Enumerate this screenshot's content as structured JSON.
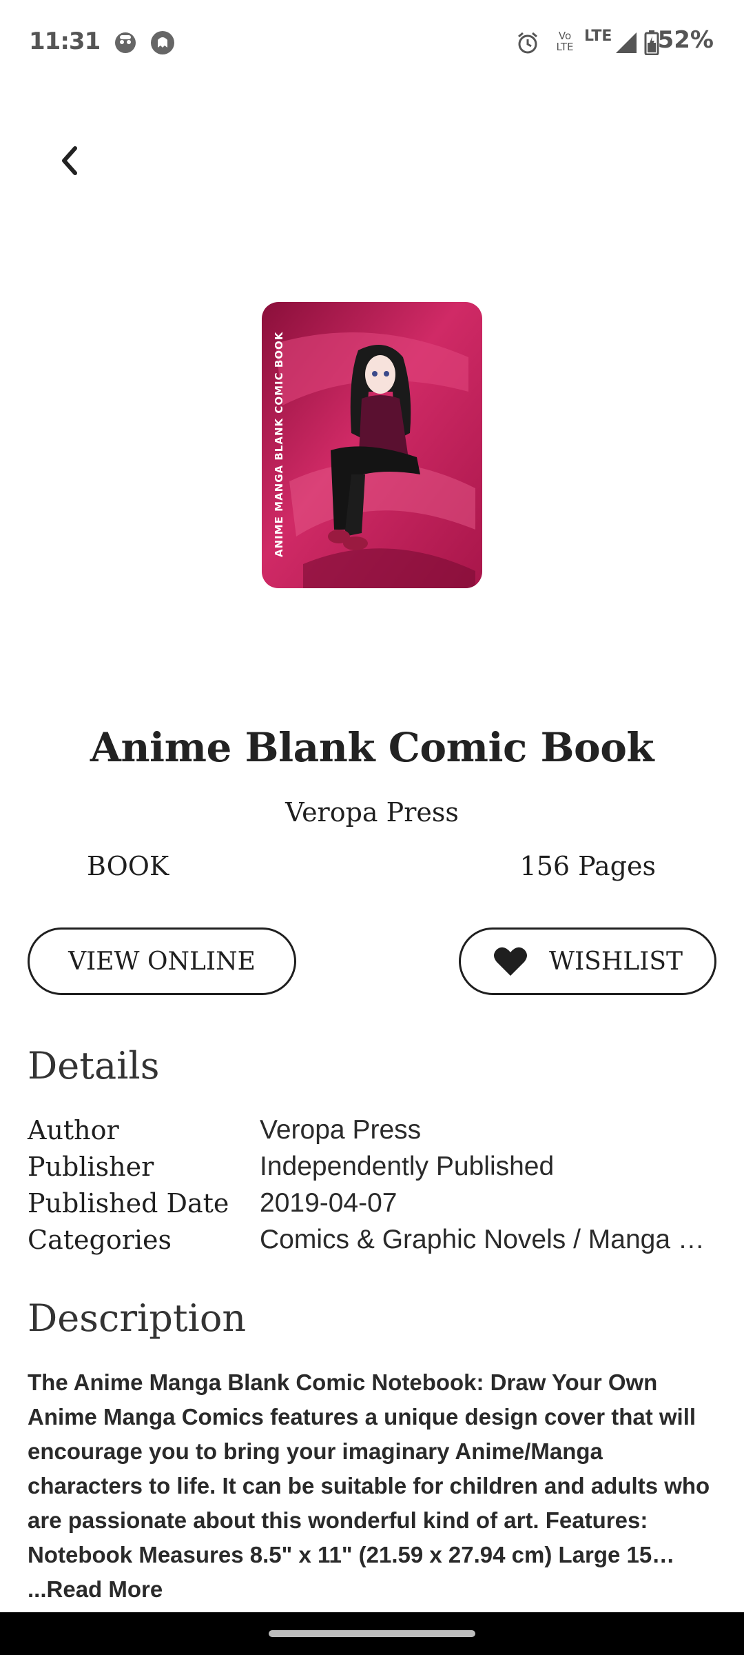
{
  "status_bar": {
    "time": "11:31",
    "battery": "52%",
    "network": "LTE",
    "volte": "Vo LTE",
    "icons": [
      "notification-face-icon",
      "notification-ghost-icon",
      "alarm-icon",
      "volte-icon",
      "lte-icon",
      "signal-icon",
      "battery-icon"
    ]
  },
  "book": {
    "title": "Anime Blank Comic Book",
    "author": "Veropa Press",
    "type": "BOOK",
    "pages": "156 Pages",
    "cover_spine_text": "ANIME MANGA BLANK COMIC BOOK"
  },
  "actions": {
    "view_online": "VIEW ONLINE",
    "wishlist": "WISHLIST"
  },
  "details": {
    "heading": "Details",
    "rows": [
      {
        "label": "Author",
        "value": "Veropa Press"
      },
      {
        "label": "Publisher",
        "value": "Independently Published"
      },
      {
        "label": "Published Date",
        "value": "2019-04-07"
      },
      {
        "label": "Categories",
        "value": "Comics & Graphic Novels / Manga …"
      }
    ]
  },
  "description": {
    "heading": "Description",
    "text": "The Anime Manga Blank Comic Notebook: Draw Your Own Anime Manga Comics features a unique design cover that will encourage you to bring your imaginary Anime/Manga characters to life. It can be suitable for children and adults who are passionate about this wonderful kind of art. Features:  Notebook Measures 8.5\" x 11\" (21.59 x 27.94 cm) Large 15… ",
    "read_more": "...Read More"
  },
  "colors": {
    "cover_primary": "#c0205a",
    "cover_dark": "#8a0f3a",
    "text": "#1f1f1f"
  }
}
